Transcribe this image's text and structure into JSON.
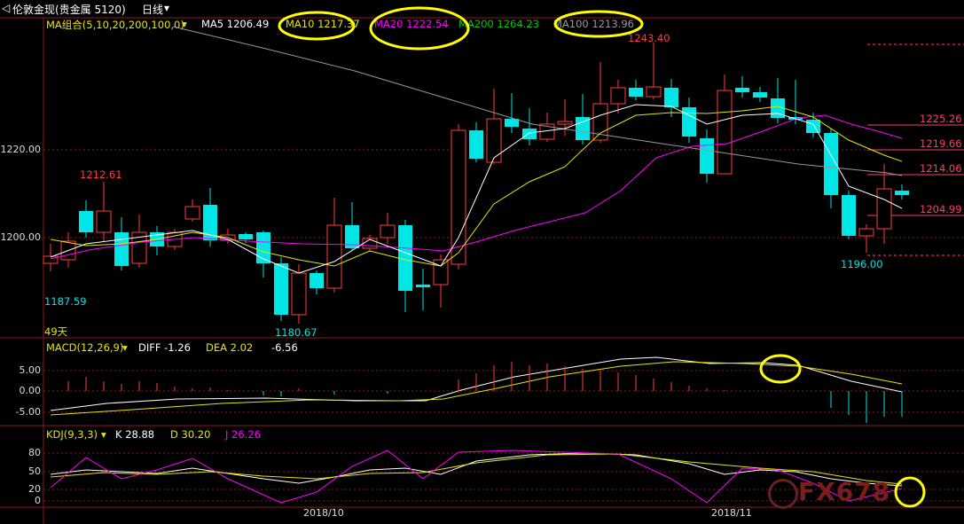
{
  "header": {
    "instrument": "伦敦金现(贵金属 5120)",
    "period": "日线",
    "period_arrow": "▾"
  },
  "ma_line": {
    "title": "MA组合(5,10,20,200,100,0)",
    "arrow": "▾",
    "ma5": "MA5 1206.49",
    "ma10": "MA10 1217.37",
    "ma20": "MA20 1222.54",
    "ma200": "MA200 1264.23",
    "ma100": "MA100 1213.96"
  },
  "price_axis": [
    "1220.00",
    "1200.00"
  ],
  "price_labels": {
    "high_left": "1212.61",
    "low_left": "1187.59",
    "low_mid": "1180.67",
    "high_top": "1243.40",
    "low_right": "1196.00",
    "days": "49天"
  },
  "right_levels": [
    "1225.26",
    "1219.66",
    "1214.06",
    "1204.99"
  ],
  "macd": {
    "title": "MACD(12,26,9)",
    "arrow": "▾",
    "diff": "DIFF -1.26",
    "dea": "DEA 2.02",
    "macd": "-6.56",
    "axis": [
      "5.00",
      "0.00",
      "-5.00"
    ]
  },
  "kdj": {
    "title": "KDJ(9,3,3)",
    "arrow": "▾",
    "k": "K 28.88",
    "d": "D 30.20",
    "j": "J 26.26",
    "axis": [
      "80",
      "50",
      "20",
      "0"
    ]
  },
  "dates": [
    "2018/10",
    "2018/11"
  ],
  "watermark": "FX678",
  "colors": {
    "up": "#ff3b3b",
    "down": "#00e5e5",
    "ma5": "#ffffff",
    "ma10": "#e6e600",
    "ma20": "#ff00ff",
    "ma200": "#00cc00",
    "ma100": "#999999",
    "highlight": "#ffff00"
  }
}
